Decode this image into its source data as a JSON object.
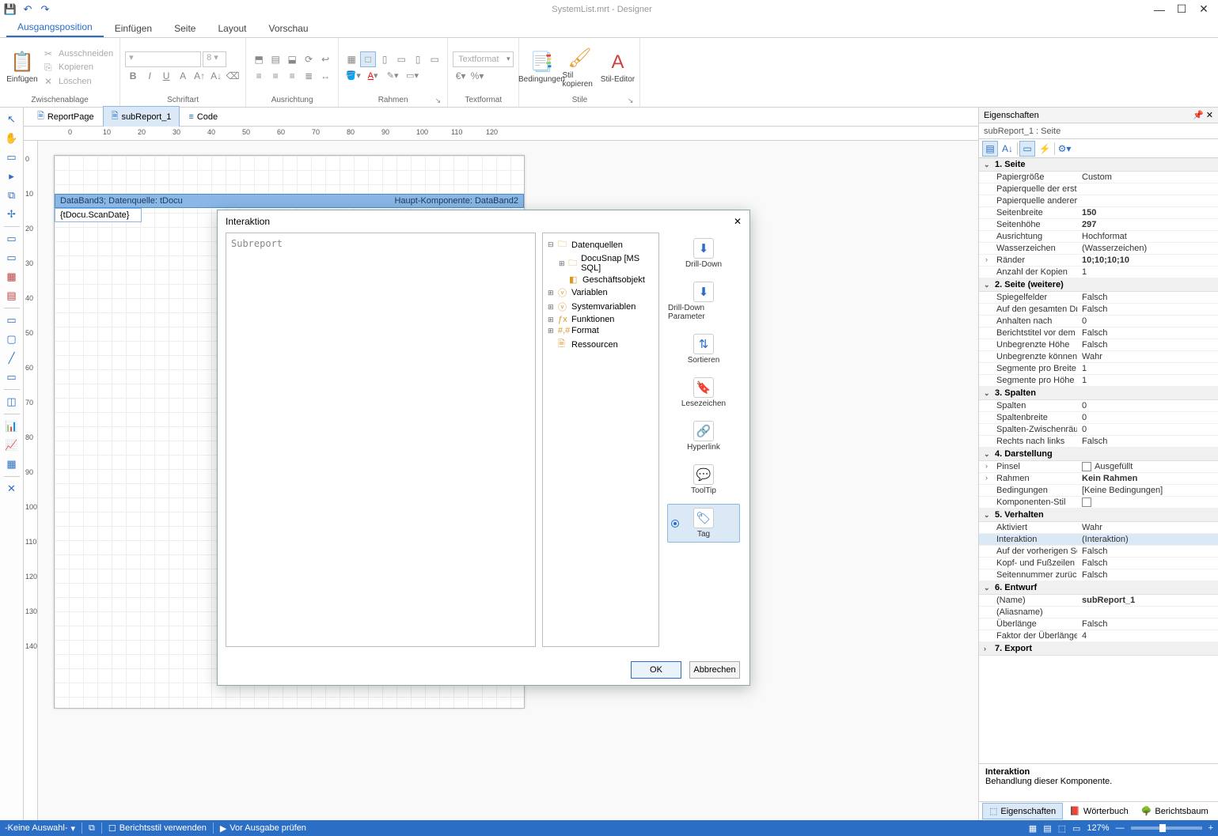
{
  "title": "SystemList.mrt - Designer",
  "ribbon_tabs": [
    "Ausgangsposition",
    "Einfügen",
    "Seite",
    "Layout",
    "Vorschau"
  ],
  "active_ribbon_tab": 0,
  "ribbon": {
    "clipboard": {
      "insert": "Einfügen",
      "cut": "Ausschneiden",
      "copy": "Kopieren",
      "delete": "Löschen",
      "label": "Zwischenablage"
    },
    "font": {
      "name": "",
      "size": "8",
      "label": "Schriftart"
    },
    "alignment": {
      "label": "Ausrichtung"
    },
    "border": {
      "label": "Rahmen"
    },
    "textformat": {
      "dd": "Textformat",
      "label": "Textformat"
    },
    "styles": {
      "conditions": "Bedingungen",
      "copy_style": "Stil kopieren",
      "editor": "Stil-Editor",
      "label": "Stile"
    }
  },
  "doc_tabs": [
    {
      "label": "ReportPage",
      "active": false
    },
    {
      "label": "subReport_1",
      "active": true
    },
    {
      "label": "Code",
      "active": false
    }
  ],
  "ruler_h": [
    "0",
    "10",
    "20",
    "30",
    "40",
    "50",
    "60",
    "70",
    "80",
    "90",
    "100",
    "110",
    "120"
  ],
  "ruler_v": [
    "0",
    "10",
    "20",
    "30",
    "40",
    "50",
    "60",
    "70",
    "80",
    "90",
    "100",
    "110",
    "120",
    "130",
    "140"
  ],
  "band": {
    "left": "DataBand3; Datenquelle: tDocu",
    "right": "Haupt-Komponente: DataBand2",
    "cell": "{tDocu.ScanDate}"
  },
  "props": {
    "title": "Eigenschaften",
    "selector": "subReport_1 : Seite",
    "categories": [
      {
        "name": "1. Seite",
        "open": true,
        "rows": [
          {
            "k": "Papiergröße",
            "v": "Custom"
          },
          {
            "k": "Papierquelle der ersten",
            "v": ""
          },
          {
            "k": "Papierquelle anderer S",
            "v": ""
          },
          {
            "k": "Seitenbreite",
            "v": "150",
            "bold": true
          },
          {
            "k": "Seitenhöhe",
            "v": "297",
            "bold": true
          },
          {
            "k": "Ausrichtung",
            "v": "Hochformat"
          },
          {
            "k": "Wasserzeichen",
            "v": "(Wasserzeichen)"
          },
          {
            "k": "Ränder",
            "v": "10;10;10;10",
            "bold": true,
            "expand": true
          },
          {
            "k": "Anzahl der Kopien",
            "v": "1"
          }
        ]
      },
      {
        "name": "2. Seite (weitere)",
        "open": true,
        "rows": [
          {
            "k": "Spiegelfelder",
            "v": "Falsch"
          },
          {
            "k": "Auf den gesamten Dru",
            "v": "Falsch"
          },
          {
            "k": "Anhalten nach",
            "v": "0"
          },
          {
            "k": "Berichtstitel vor dem E",
            "v": "Falsch"
          },
          {
            "k": "Unbegrenzte Höhe",
            "v": "Falsch"
          },
          {
            "k": "Unbegrenzte können",
            "v": "Wahr"
          },
          {
            "k": "Segmente pro Breite",
            "v": "1"
          },
          {
            "k": "Segmente pro Höhe",
            "v": "1"
          }
        ]
      },
      {
        "name": "3. Spalten",
        "open": true,
        "rows": [
          {
            "k": "Spalten",
            "v": "0"
          },
          {
            "k": "Spaltenbreite",
            "v": "0"
          },
          {
            "k": "Spalten-Zwischenräum",
            "v": "0"
          },
          {
            "k": "Rechts nach links",
            "v": "Falsch"
          }
        ]
      },
      {
        "name": "4. Darstellung",
        "open": true,
        "rows": [
          {
            "k": "Pinsel",
            "v": "Ausgefüllt",
            "checkbox": true,
            "expand": true
          },
          {
            "k": "Rahmen",
            "v": "Kein Rahmen",
            "bold": true,
            "expand": true
          },
          {
            "k": "Bedingungen",
            "v": "[Keine Bedingungen]"
          },
          {
            "k": "Komponenten-Stil",
            "v": "",
            "checkbox": true
          }
        ]
      },
      {
        "name": "5. Verhalten",
        "open": true,
        "rows": [
          {
            "k": "Aktiviert",
            "v": "Wahr"
          },
          {
            "k": "Interaktion",
            "v": "(Interaktion)",
            "sel": true
          },
          {
            "k": "Auf der vorherigen Se",
            "v": "Falsch"
          },
          {
            "k": "Kopf- und Fußzeilen v",
            "v": "Falsch"
          },
          {
            "k": "Seitennummer zurück",
            "v": "Falsch"
          }
        ]
      },
      {
        "name": "6. Entwurf",
        "open": true,
        "rows": [
          {
            "k": "(Name)",
            "v": "subReport_1",
            "bold": true
          },
          {
            "k": "(Aliasname)",
            "v": ""
          },
          {
            "k": "Überlänge",
            "v": "Falsch"
          },
          {
            "k": "Faktor der Überlänge",
            "v": "4"
          }
        ]
      },
      {
        "name": "7. Export",
        "open": false,
        "rows": []
      }
    ],
    "desc_title": "Interaktion",
    "desc_body": "Behandlung dieser Komponente.",
    "bottom_tabs": [
      "Eigenschaften",
      "Wörterbuch",
      "Berichtsbaum"
    ]
  },
  "status": {
    "left": "-Keine Auswahl-",
    "style": "Berichtsstil verwenden",
    "check": "Vor Ausgabe prüfen",
    "zoom": "127%"
  },
  "dialog": {
    "title": "Interaktion",
    "textarea": "Subreport",
    "tree": [
      {
        "exp": "⊟",
        "ic": "🗀",
        "label": "Datenquellen",
        "indent": 0
      },
      {
        "exp": "⊞",
        "ic": "🗀",
        "label": "DocuSnap [MS SQL]",
        "indent": 1,
        "iccolor": "#d99a2a"
      },
      {
        "exp": "",
        "ic": "◧",
        "label": "Geschäftsobjekt",
        "indent": 1
      },
      {
        "exp": "⊞",
        "ic": "ⓥ",
        "label": "Variablen",
        "indent": 0
      },
      {
        "exp": "⊞",
        "ic": "ⓥ",
        "label": "Systemvariablen",
        "indent": 0
      },
      {
        "exp": "⊞",
        "ic": "ƒx",
        "label": "Funktionen",
        "indent": 0
      },
      {
        "exp": "⊞",
        "ic": "#,#",
        "label": "Format",
        "indent": 0
      },
      {
        "exp": "",
        "ic": "🗎",
        "label": "Ressourcen",
        "indent": 0
      }
    ],
    "sidebar": [
      {
        "label": "Drill-Down",
        "ic": "⬇"
      },
      {
        "label": "Drill-Down Parameter",
        "ic": "⬇"
      },
      {
        "label": "Sortieren",
        "ic": "⇅"
      },
      {
        "label": "Lesezeichen",
        "ic": "🔖"
      },
      {
        "label": "Hyperlink",
        "ic": "🔗"
      },
      {
        "label": "ToolTip",
        "ic": "💬"
      },
      {
        "label": "Tag",
        "ic": "🏷",
        "active": true
      }
    ],
    "ok": "OK",
    "cancel": "Abbrechen"
  }
}
